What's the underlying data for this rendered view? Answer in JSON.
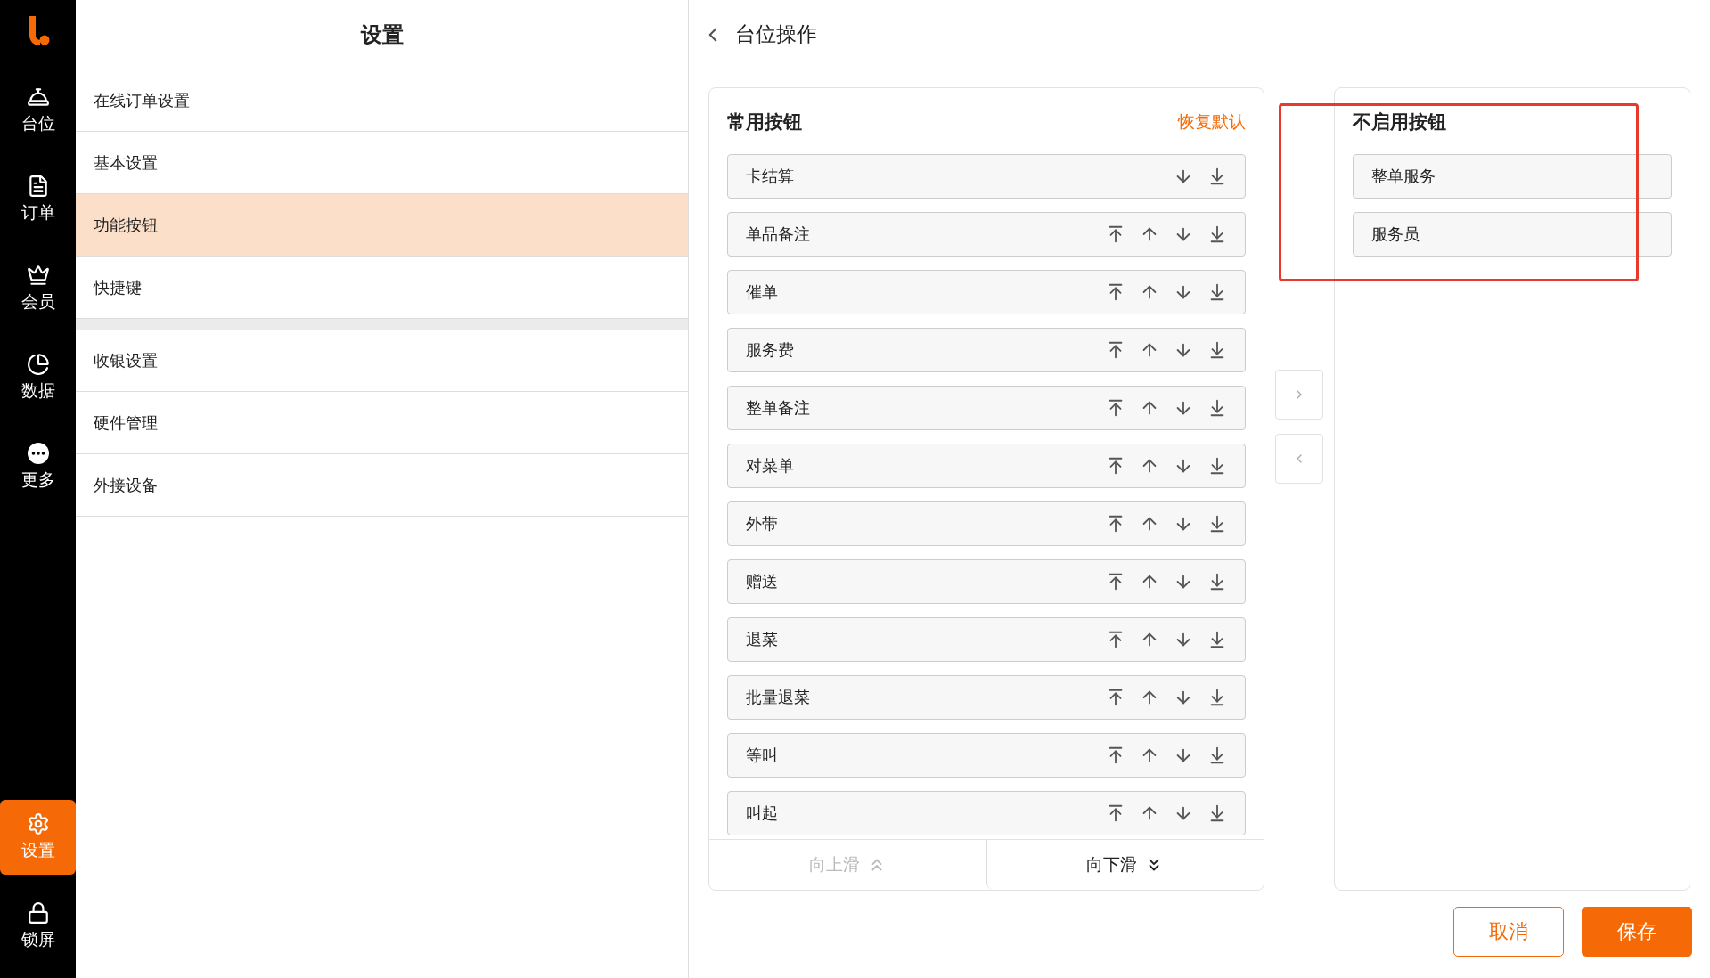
{
  "nav": {
    "items": [
      {
        "label": "台位",
        "selected": false
      },
      {
        "label": "订单",
        "selected": false
      },
      {
        "label": "会员",
        "selected": false
      },
      {
        "label": "数据",
        "selected": false
      },
      {
        "label": "更多",
        "selected": false
      }
    ],
    "bottom_items": [
      {
        "label": "设置",
        "selected": true
      },
      {
        "label": "锁屏",
        "selected": false
      }
    ]
  },
  "settings": {
    "title": "设置",
    "groups": [
      {
        "items": [
          {
            "label": "在线订单设置",
            "selected": false
          },
          {
            "label": "基本设置",
            "selected": false
          },
          {
            "label": "功能按钮",
            "selected": true
          },
          {
            "label": "快捷键",
            "selected": false
          }
        ]
      },
      {
        "items": [
          {
            "label": "收银设置",
            "selected": false
          },
          {
            "label": "硬件管理",
            "selected": false
          },
          {
            "label": "外接设备",
            "selected": false
          }
        ]
      }
    ]
  },
  "page": {
    "title": "台位操作"
  },
  "common": {
    "title": "常用按钮",
    "reset": "恢复默认",
    "rows": [
      {
        "label": "卡结算",
        "can_move_up": false
      },
      {
        "label": "单品备注",
        "can_move_up": true
      },
      {
        "label": "催单",
        "can_move_up": true
      },
      {
        "label": "服务费",
        "can_move_up": true
      },
      {
        "label": "整单备注",
        "can_move_up": true
      },
      {
        "label": "对菜单",
        "can_move_up": true
      },
      {
        "label": "外带",
        "can_move_up": true
      },
      {
        "label": "赠送",
        "can_move_up": true
      },
      {
        "label": "退菜",
        "can_move_up": true
      },
      {
        "label": "批量退菜",
        "can_move_up": true
      },
      {
        "label": "等叫",
        "can_move_up": true
      },
      {
        "label": "叫起",
        "can_move_up": true
      }
    ],
    "scroll_up": {
      "label": "向上滑",
      "disabled": true
    },
    "scroll_down": {
      "label": "向下滑",
      "disabled": false
    }
  },
  "disabled_buttons": {
    "title": "不启用按钮",
    "rows": [
      {
        "label": "整单服务"
      },
      {
        "label": "服务员"
      }
    ],
    "highlighted": true
  },
  "footer": {
    "cancel": "取消",
    "save": "保存"
  }
}
